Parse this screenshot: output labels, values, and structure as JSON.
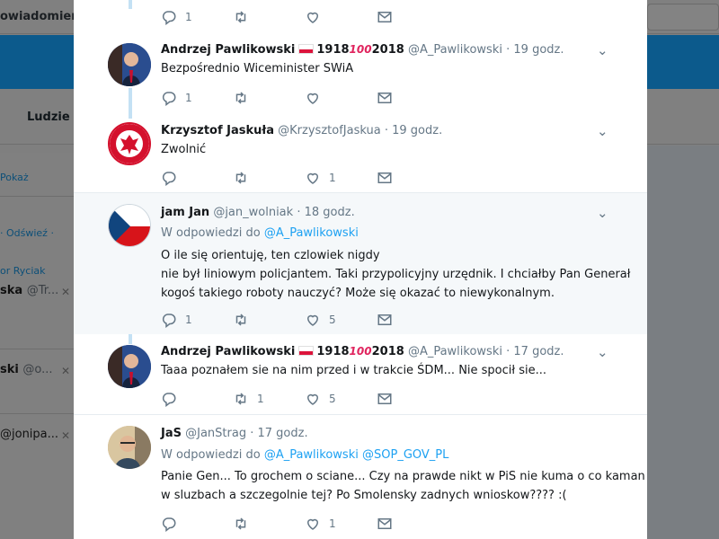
{
  "background": {
    "topbar_text": "owiadomienia",
    "nav_ludzie": "Ludzie",
    "pokaz": "Pokaż",
    "odswiez": "· Odświeź ·",
    "ryciak": "or Ryciak",
    "r1": {
      "name": "ska",
      "handle": "@Tr..."
    },
    "r2": {
      "name": "ski",
      "handle": "@o..."
    },
    "r3": {
      "handle": "@jonipa..."
    },
    "close_glyph": "✕"
  },
  "icons": {
    "reply": "reply-icon",
    "retweet": "retweet-icon",
    "like": "heart-icon",
    "dm": "envelope-icon",
    "caret": "chevron-down-icon"
  },
  "colors": {
    "accent": "#1da1f2",
    "muted": "#657786",
    "thread": "#c4e1f4",
    "brand_bg": "#0c5a8c"
  },
  "tweets": [
    {
      "reply_count": "1",
      "retweet_count": "",
      "like_count": "",
      "dm_count": ""
    },
    {
      "name": "Andrzej Pawlikowski",
      "year_start": "1918",
      "hundred": "100",
      "year_end": "2018",
      "handle": "@A_Pawlikowski",
      "sep": "·",
      "time": "19 godz.",
      "text": "Bezpośrednio Wiceminister SWiA",
      "reply_count": "1",
      "retweet_count": "",
      "like_count": "",
      "dm_count": ""
    },
    {
      "name": "Krzysztof Jaskuła",
      "handle": "@KrzysztofJaskua",
      "sep": "·",
      "time": "19 godz.",
      "text": "Zwolnić",
      "reply_count": "",
      "retweet_count": "",
      "like_count": "1",
      "dm_count": ""
    },
    {
      "name": "jam Jan",
      "handle": "@jan_wolniak",
      "sep": "·",
      "time": "18 godz.",
      "reply_prefix": "W odpowiedzi do",
      "reply_mention": "@A_Pawlikowski",
      "lines": [
        "O ile się orientuję, ten czlowiek nigdy",
        "nie był liniowym policjantem. Taki przypolicyjny urzędnik. I chciałby Pan Generał",
        "kogoś takiego roboty nauczyć? Może się okazać to niewykonalnym."
      ],
      "reply_count": "1",
      "retweet_count": "",
      "like_count": "5",
      "dm_count": ""
    },
    {
      "name": "Andrzej Pawlikowski",
      "year_start": "1918",
      "hundred": "100",
      "year_end": "2018",
      "handle": "@A_Pawlikowski",
      "sep": "·",
      "time": "17 godz.",
      "text": "Taaa poznałem sie na nim przed i w trakcie ŚDM... Nie spocił sie...",
      "reply_count": "",
      "retweet_count": "1",
      "like_count": "5",
      "dm_count": ""
    },
    {
      "name": "JaS",
      "handle": "@JanStrag",
      "sep": "·",
      "time": "17 godz.",
      "reply_prefix": "W odpowiedzi do",
      "reply_mention": "@A_Pawlikowski",
      "reply_mention_2": "@SOP_GOV_PL",
      "lines": [
        "Panie Gen... To grochem o sciane... Czy na prawde nikt w PiS nie kuma o co kaman",
        "w sluzbach a szczegolnie tej? Po Smolensky zadnych wnioskow???? :("
      ],
      "reply_count": "",
      "retweet_count": "",
      "like_count": "1",
      "dm_count": ""
    }
  ]
}
